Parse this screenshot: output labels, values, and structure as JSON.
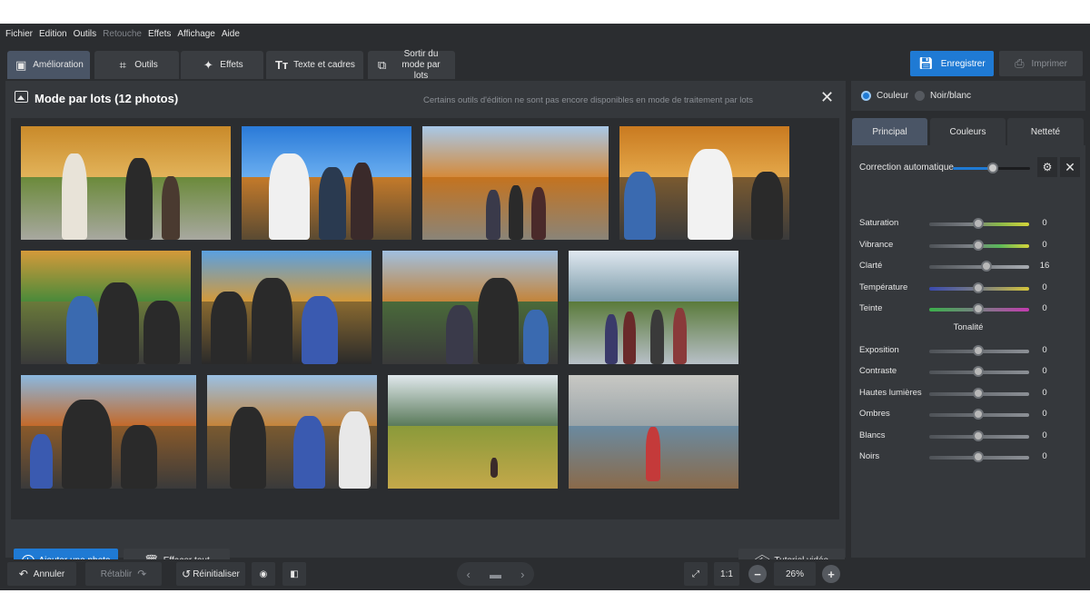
{
  "menu": [
    "Fichier",
    "Edition",
    "Outils",
    "Retouche",
    "Effets",
    "Affichage",
    "Aide"
  ],
  "menu_disabled": [
    "Retouche"
  ],
  "toolbar": {
    "tabs": [
      {
        "label": "Amélioration",
        "icon": "image-enhance-icon"
      },
      {
        "label": "Outils",
        "icon": "crop-icon"
      },
      {
        "label": "Effets",
        "icon": "magic-wand-icon"
      },
      {
        "label": "Texte et cadres",
        "icon": "text-icon"
      },
      {
        "label": "Sortir du mode par lots",
        "icon": "exit-batch-icon"
      }
    ],
    "save_label": "Enregistrer",
    "print_label": "Imprimer"
  },
  "batch": {
    "title": "Mode par lots (12 photos)",
    "note": "Certains outils d'édition ne sont pas encore disponibles en mode de traitement par lots",
    "add_photo_label": "Ajouter une photo",
    "clear_all_label": "Effacer tout",
    "tutorial_label": "Tutoriel vidéo"
  },
  "footer": {
    "undo_label": "Annuler",
    "redo_label": "Rétablir",
    "reset_label": "Réinitialiser",
    "ratio_label": "1:1",
    "zoom": "26%"
  },
  "color_mode": {
    "option_color": "Couleur",
    "option_bw": "Noir/blanc",
    "selected": "Couleur"
  },
  "right_tabs": [
    "Principal",
    "Couleurs",
    "Netteté"
  ],
  "auto_correction": {
    "label": "Correction automatique",
    "level": 0.54
  },
  "sliders": [
    {
      "label": "Saturation",
      "value": "0"
    },
    {
      "label": "Vibrance",
      "value": "0"
    },
    {
      "label": "Clarté",
      "value": "16"
    },
    {
      "label": "Température",
      "value": "0"
    },
    {
      "label": "Teinte",
      "value": "0"
    }
  ],
  "tonalite_title": "Tonalité",
  "tone_sliders": [
    {
      "label": "Exposition",
      "value": "0"
    },
    {
      "label": "Contraste",
      "value": "0"
    },
    {
      "label": "Hautes lumières",
      "value": "0"
    },
    {
      "label": "Ombres",
      "value": "0"
    },
    {
      "label": "Blancs",
      "value": "0"
    },
    {
      "label": "Noirs",
      "value": "0"
    }
  ],
  "colors": {
    "accent": "#1f7ad4",
    "background": "#2b2d30",
    "panel": "#35383c"
  }
}
